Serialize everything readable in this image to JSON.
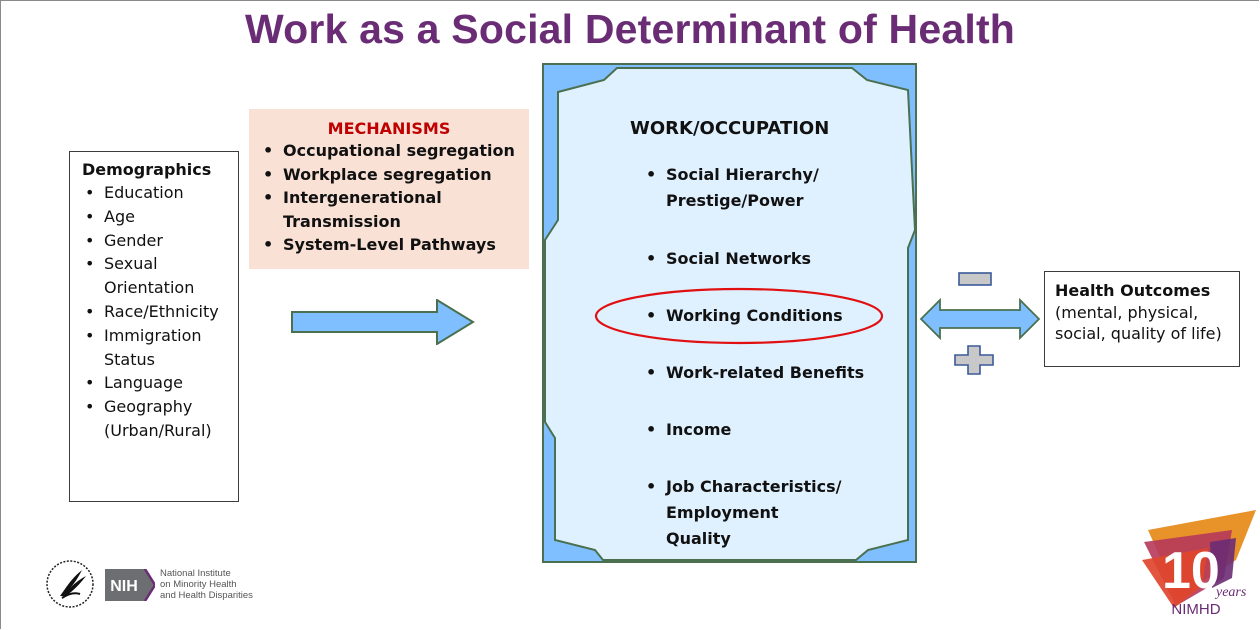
{
  "title": "Work as a Social Determinant of Health",
  "colors": {
    "title": "#6a2c74",
    "mechanisms_bg": "#f9e1d6",
    "mechanisms_title": "#c00000",
    "work_box_outer": "#7fbfff",
    "work_box_inner": "#dff0ff",
    "shape_stroke": "#4a7050",
    "highlight_ellipse": "#e01010",
    "sign_fill": "#c8c8c8",
    "sign_stroke": "#3a5a9a"
  },
  "demographics": {
    "title": "Demographics",
    "items": [
      "Education",
      "Age",
      "Gender",
      "Sexual Orientation",
      "Race/Ethnicity",
      "Immigration Status",
      "Language",
      "Geography (Urban/Rural)"
    ]
  },
  "mechanisms": {
    "title": "MECHANISMS",
    "items": [
      "Occupational segregation",
      "Workplace segregation",
      "Intergenerational Transmission",
      "System-Level Pathways"
    ]
  },
  "work": {
    "title": "WORK/OCCUPATION",
    "items": [
      "Social Hierarchy/ Prestige/Power",
      "Social Networks",
      "Working Conditions",
      "Work-related Benefits",
      "Income",
      "Job Characteristics/ Employment Quality"
    ],
    "highlighted_item": "Working Conditions"
  },
  "relationship_signs": {
    "negative": "minus-icon",
    "positive": "plus-icon"
  },
  "health_outcomes": {
    "title": "Health Outcomes",
    "detail": "(mental, physical, social, quality of life)"
  },
  "footer": {
    "nih_badge": "NIH",
    "institute_lines": [
      "National Institute",
      "on Minority Health",
      "and Health Disparities"
    ],
    "anniversary_number": "10",
    "anniversary_word": "years",
    "anniversary_org": "NIMHD"
  }
}
